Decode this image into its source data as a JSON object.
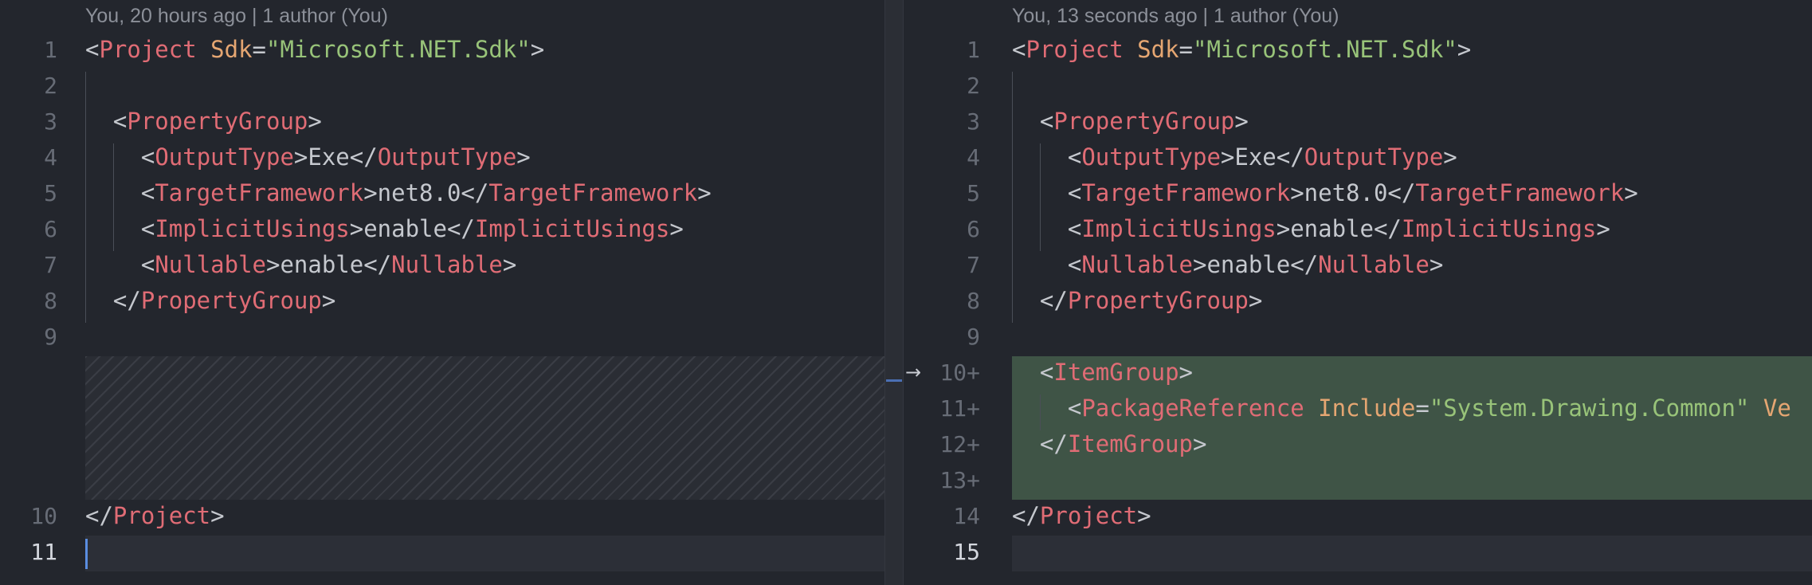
{
  "left": {
    "blame": "You, 20 hours ago | 1 author (You)",
    "line_numbers": [
      "1",
      "2",
      "3",
      "4",
      "5",
      "6",
      "7",
      "8",
      "9",
      "10",
      "11"
    ],
    "lines": {
      "l1": {
        "o": "<",
        "tag": "Project",
        "sp": " ",
        "attr": "Sdk",
        "eq": "=",
        "val": "\"Microsoft.NET.Sdk\"",
        "c": ">"
      },
      "l3": {
        "o": "<",
        "tag": "PropertyGroup",
        "c": ">"
      },
      "l4": {
        "o": "<",
        "tag": "OutputType",
        "mid": ">Exe</",
        "tag2": "OutputType",
        "c": ">"
      },
      "l5": {
        "o": "<",
        "tag": "TargetFramework",
        "mid": ">net8.0</",
        "tag2": "TargetFramework",
        "c": ">"
      },
      "l6": {
        "o": "<",
        "tag": "ImplicitUsings",
        "mid": ">enable</",
        "tag2": "ImplicitUsings",
        "c": ">"
      },
      "l7": {
        "o": "<",
        "tag": "Nullable",
        "mid": ">enable</",
        "tag2": "Nullable",
        "c": ">"
      },
      "l8": {
        "o": "</",
        "tag": "PropertyGroup",
        "c": ">"
      },
      "l10": {
        "o": "</",
        "tag": "Project",
        "c": ">"
      }
    }
  },
  "right": {
    "blame": "You, 13 seconds ago | 1 author (You)",
    "line_numbers": [
      "1",
      "2",
      "3",
      "4",
      "5",
      "6",
      "7",
      "8",
      "9",
      "10",
      "11",
      "12",
      "13",
      "14",
      "15"
    ],
    "plus": "+",
    "lines": {
      "l1": {
        "o": "<",
        "tag": "Project",
        "sp": " ",
        "attr": "Sdk",
        "eq": "=",
        "val": "\"Microsoft.NET.Sdk\"",
        "c": ">"
      },
      "l3": {
        "o": "<",
        "tag": "PropertyGroup",
        "c": ">"
      },
      "l4": {
        "o": "<",
        "tag": "OutputType",
        "mid": ">Exe</",
        "tag2": "OutputType",
        "c": ">"
      },
      "l5": {
        "o": "<",
        "tag": "TargetFramework",
        "mid": ">net8.0</",
        "tag2": "TargetFramework",
        "c": ">"
      },
      "l6": {
        "o": "<",
        "tag": "ImplicitUsings",
        "mid": ">enable</",
        "tag2": "ImplicitUsings",
        "c": ">"
      },
      "l7": {
        "o": "<",
        "tag": "Nullable",
        "mid": ">enable</",
        "tag2": "Nullable",
        "c": ">"
      },
      "l8": {
        "o": "</",
        "tag": "PropertyGroup",
        "c": ">"
      },
      "l10": {
        "o": "<",
        "tag": "ItemGroup",
        "c": ">"
      },
      "l11": {
        "o": "<",
        "tag": "PackageReference",
        "sp": " ",
        "attr": "Include",
        "eq": "=",
        "val": "\"System.Drawing.Common\"",
        "sp2": " ",
        "attr2": "Ve"
      },
      "l12": {
        "o": "</",
        "tag": "ItemGroup",
        "c": ">"
      },
      "l14": {
        "o": "</",
        "tag": "Project",
        "c": ">"
      }
    }
  },
  "arrow_glyph": "→",
  "colors": {
    "tag": "#e06c75",
    "attr": "#e5a672",
    "string": "#98c379",
    "added_bg": "#3f5446",
    "caret": "#5a8de0"
  }
}
